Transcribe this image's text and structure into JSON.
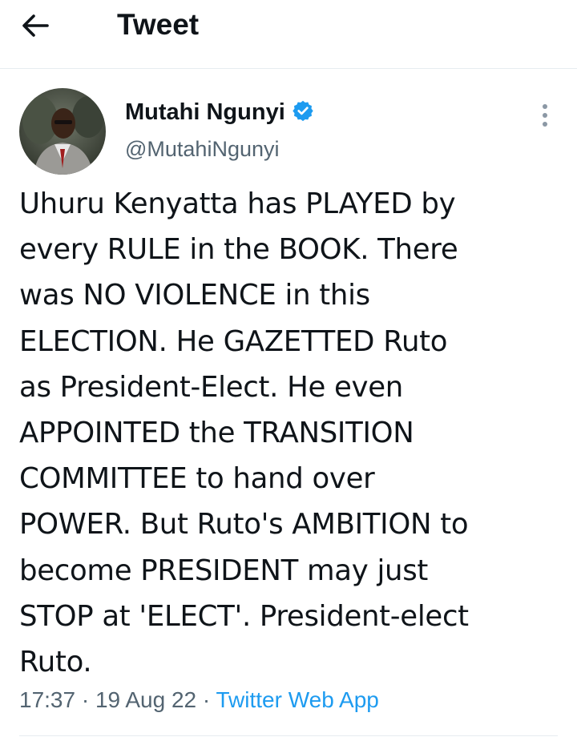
{
  "header": {
    "title": "Tweet",
    "back_icon": "arrow-left-icon"
  },
  "author": {
    "display_name": "Mutahi Ngunyi",
    "handle": "@MutahiNgunyi",
    "verified": true,
    "verified_color": "#1d9bf0"
  },
  "tweet": {
    "lines": [
      "Uhuru Kenyatta has PLAYED by",
      "every RULE in the BOOK. There",
      "was NO VIOLENCE in this",
      "ELECTION. He GAZETTED Ruto",
      "as President-Elect. He even",
      "APPOINTED the TRANSITION",
      "COMMITTEE to hand over",
      "POWER. But Ruto's AMBITION to",
      "become PRESIDENT may just",
      "STOP at 'ELECT'. President-elect",
      "Ruto."
    ],
    "time": "17:37",
    "date": "19 Aug 22",
    "separator": "·",
    "source": "Twitter Web App"
  },
  "colors": {
    "text": "#0f1419",
    "secondary": "#536471",
    "link": "#1d9bf0",
    "divider": "#e6ecf0"
  }
}
